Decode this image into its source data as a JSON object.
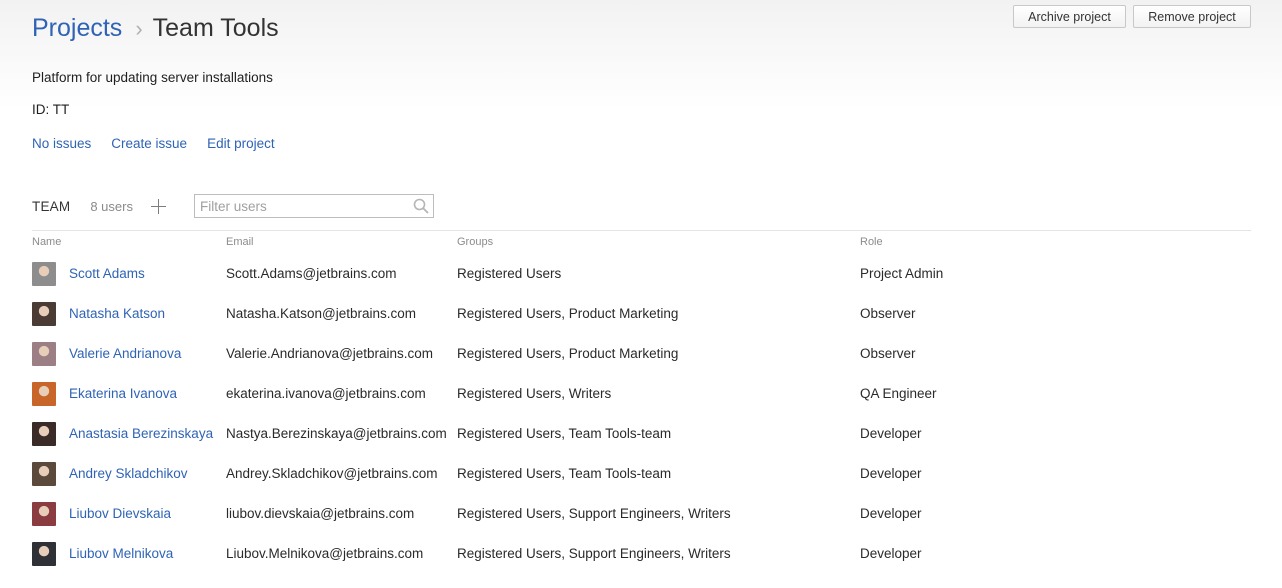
{
  "breadcrumb": {
    "root": "Projects",
    "separator": "›",
    "current": "Team Tools"
  },
  "buttons": {
    "archive": "Archive project",
    "remove": "Remove project"
  },
  "project": {
    "description": "Platform for updating server installations",
    "id_label": "ID: TT",
    "links": {
      "issues": "No issues",
      "create": "Create issue",
      "edit": "Edit project"
    }
  },
  "team": {
    "label": "TEAM",
    "count": "8 users",
    "filter_placeholder": "Filter users",
    "columns": {
      "name": "Name",
      "email": "Email",
      "groups": "Groups",
      "role": "Role"
    },
    "users": [
      {
        "name": "Scott Adams",
        "email": "Scott.Adams@jetbrains.com",
        "groups": "Registered Users",
        "role": "Project Admin",
        "avatar_color": "#8d8d8d"
      },
      {
        "name": "Natasha Katson",
        "email": "Natasha.Katson@jetbrains.com",
        "groups": "Registered Users, Product Marketing",
        "role": "Observer",
        "avatar_color": "#4a3b34"
      },
      {
        "name": "Valerie Andrianova",
        "email": "Valerie.Andrianova@jetbrains.com",
        "groups": "Registered Users, Product Marketing",
        "role": "Observer",
        "avatar_color": "#9b7f84"
      },
      {
        "name": "Ekaterina Ivanova",
        "email": "ekaterina.ivanova@jetbrains.com",
        "groups": "Registered Users, Writers",
        "role": "QA Engineer",
        "avatar_color": "#c8662a"
      },
      {
        "name": "Anastasia Berezinskaya",
        "email": "Nastya.Berezinskaya@jetbrains.com",
        "groups": "Registered Users, Team Tools-team",
        "role": "Developer",
        "avatar_color": "#3a2a28"
      },
      {
        "name": "Andrey Skladchikov",
        "email": "Andrey.Skladchikov@jetbrains.com",
        "groups": "Registered Users, Team Tools-team",
        "role": "Developer",
        "avatar_color": "#5b4a3c"
      },
      {
        "name": "Liubov Dievskaia",
        "email": "liubov.dievskaia@jetbrains.com",
        "groups": "Registered Users, Support Engineers, Writers",
        "role": "Developer",
        "avatar_color": "#8a3c40"
      },
      {
        "name": "Liubov Melnikova",
        "email": "Liubov.Melnikova@jetbrains.com",
        "groups": "Registered Users, Support Engineers, Writers",
        "role": "Developer",
        "avatar_color": "#2f3136"
      }
    ]
  }
}
